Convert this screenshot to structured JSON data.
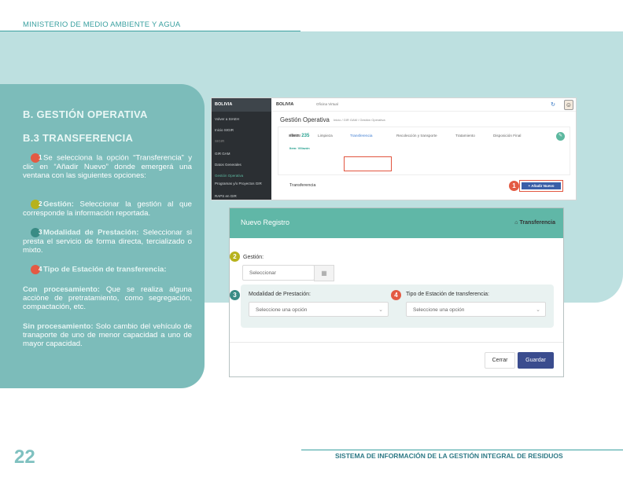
{
  "header": {
    "ministry": "MINISTERIO DE MEDIO AMBIENTE Y AGUA"
  },
  "panel": {
    "section": "B. GESTIÓN OPERATIVA",
    "subsection": "B.3 TRANSFERENCIA",
    "p1_num": "1",
    "p1": "Se selecciona la opción “Transferencia” y clic en “Añadir Nuevo” donde emergerá una ventana con las siguientes opciones:",
    "p2_num": "2",
    "p2_label": "Gestión:",
    "p2": "Seleccionar la gestión al que corresponde la información reportada.",
    "p3_num": "3",
    "p3_label": "Modalidad de Prestación:",
    "p3": "Seleccionar si presta el servicio de forma directa, tercializado o mixto.",
    "p4_num": "4",
    "p4_label": "Tipo de Estación de transferencia:",
    "p5_label": "Con procesamiento:",
    "p5": "Que se realiza alguna acciòne de pretratamiento, como segregación, compactación, etc.",
    "p6_label": "Sin procesamiento:",
    "p6": "Solo cambio del vehículo de tranaporte de uno de menor capacidad a uno de mayor capacidad."
  },
  "app": {
    "side_logo": "BOLIVIA",
    "side_items": [
      "Volver a SIAEH",
      "Inicio SIGIR",
      "SIGIR",
      "GIR GAM",
      "Datos Generales",
      "Gestión Operativa",
      "Programas y/o Proyectos GIR",
      "RAPS en GIR"
    ],
    "brand": "BOLIVIA",
    "office": "Oficina Virtual",
    "page_title": "Gestión Operativa",
    "breadcrumb": "Inicio / GIR GAM / Gestión Operativa",
    "item_label": "#Item:",
    "item_value": "235",
    "item_sub": "Item: Villazón",
    "tabs": [
      "Barrido",
      "Limpieza",
      "Transferencia",
      "Recolección y transporte",
      "Tratamiento",
      "Disposición Final"
    ],
    "section_label": "Transferencia",
    "add_button": "+ Añadir Nuevo",
    "badge": "1"
  },
  "modal": {
    "title": "Nuevo Registro",
    "tag": "Transferencia",
    "gestion_label": "Gestión:",
    "gestion_placeholder": "Seleccionar",
    "modalidad_label": "Modalidad de Prestación:",
    "modalidad_placeholder": "Seleccione una opción",
    "tipo_label": "Tipo de Estación de transferencia:",
    "tipo_placeholder": "Seleccione una opción",
    "close_button": "Cerrar",
    "save_button": "Guardar",
    "badges": [
      "2",
      "3",
      "4"
    ]
  },
  "footer": {
    "page": "22",
    "system": "SISTEMA DE INFORMACIÓN DE LA GESTIÓN INTEGRAL DE RESIDUOS"
  }
}
